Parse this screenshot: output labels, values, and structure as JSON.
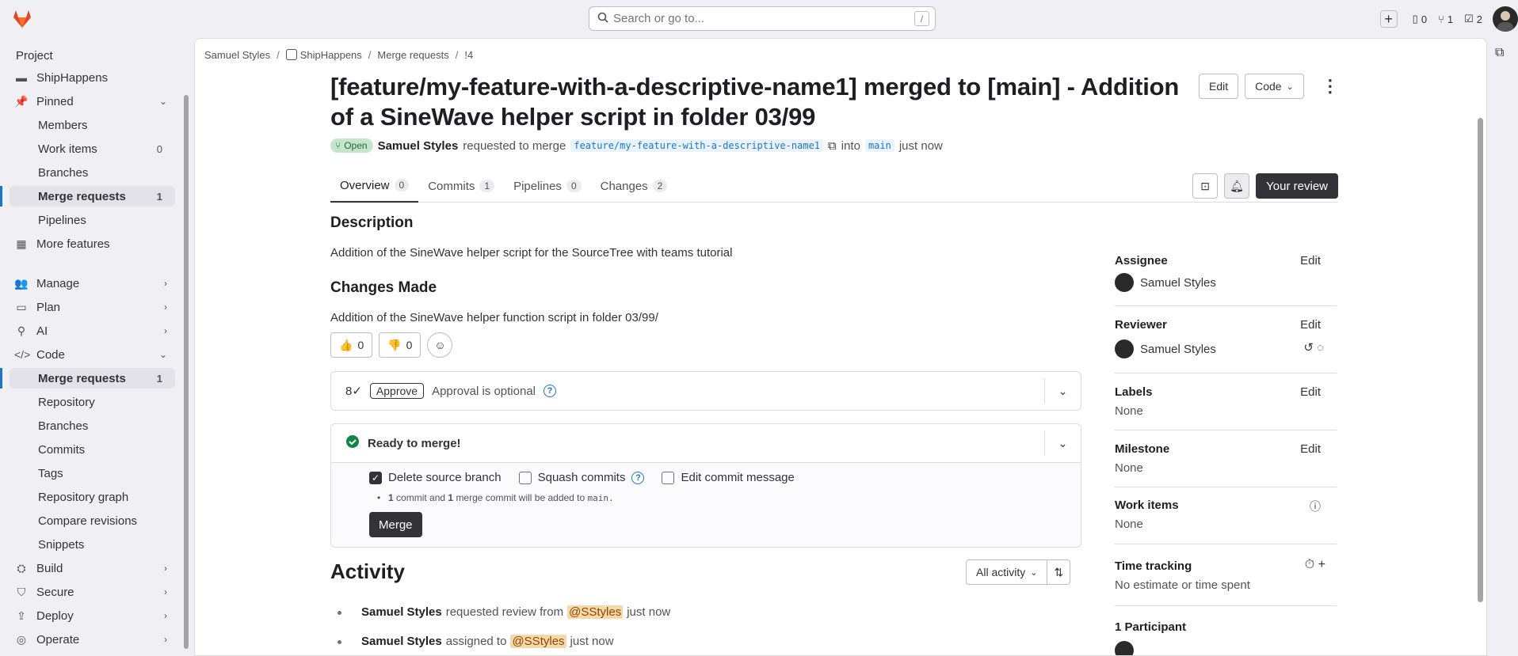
{
  "search": {
    "placeholder": "Search or go to...",
    "shortcut": "/"
  },
  "topbar": {
    "issues_count": "0",
    "mr_count": "1",
    "todo_count": "2"
  },
  "sidebar": {
    "title": "Project",
    "partial_top": "ShipHappens",
    "items": [
      {
        "label": "Pinned"
      },
      {
        "label": "Members"
      },
      {
        "label": "Work items",
        "count": "0"
      },
      {
        "label": "Branches"
      },
      {
        "label": "Merge requests",
        "count": "1"
      },
      {
        "label": "Pipelines"
      },
      {
        "label": "More features"
      },
      {
        "label": "Manage"
      },
      {
        "label": "Plan"
      },
      {
        "label": "AI"
      },
      {
        "label": "Code"
      },
      {
        "label": "Merge requests",
        "count": "1"
      },
      {
        "label": "Repository"
      },
      {
        "label": "Branches"
      },
      {
        "label": "Commits"
      },
      {
        "label": "Tags"
      },
      {
        "label": "Repository graph"
      },
      {
        "label": "Compare revisions"
      },
      {
        "label": "Snippets"
      },
      {
        "label": "Build"
      },
      {
        "label": "Secure"
      },
      {
        "label": "Deploy"
      },
      {
        "label": "Operate"
      }
    ]
  },
  "breadcrumb": [
    "Samuel Styles",
    "ShipHappens",
    "Merge requests",
    "!4"
  ],
  "mr": {
    "title": "[feature/my-feature-with-a-descriptive-name1] merged to [main] - Addition of a SineWave helper script in folder 03/99",
    "edit_label": "Edit",
    "code_label": "Code",
    "status": "Open",
    "author": "Samuel Styles",
    "requested_text": "requested to merge",
    "source_branch": "feature/my-feature-with-a-descriptive-name1",
    "into_text": "into",
    "target_branch": "main",
    "time": "just now"
  },
  "tabs": [
    {
      "label": "Overview",
      "count": "0"
    },
    {
      "label": "Commits",
      "count": "1"
    },
    {
      "label": "Pipelines",
      "count": "0"
    },
    {
      "label": "Changes",
      "count": "2"
    }
  ],
  "review_button": "Your review",
  "description": {
    "heading": "Description",
    "text": "Addition of the SineWave helper script for the SourceTree with teams tutorial",
    "changes_heading": "Changes Made",
    "changes_text": "Addition of the SineWave helper function script in folder 03/99/"
  },
  "reactions": {
    "thumbs_up": "0",
    "thumbs_down": "0"
  },
  "approval": {
    "approve_label": "Approve",
    "optional_text": "Approval is optional"
  },
  "merge": {
    "ready_text": "Ready to merge!",
    "delete_source": "Delete source branch",
    "squash": "Squash commits",
    "edit_message": "Edit commit message",
    "note_1": "1",
    "note_2": "commit and",
    "note_3": "1",
    "note_4": "merge commit will be added to",
    "note_branch": "main.",
    "merge_label": "Merge"
  },
  "activity": {
    "title": "Activity",
    "filter": "All activity",
    "items": [
      {
        "author": "Samuel Styles",
        "text": "requested review from",
        "mention": "@SStyles",
        "time": "just now"
      },
      {
        "author": "Samuel Styles",
        "text": "assigned to",
        "mention": "@SStyles",
        "time": "just now"
      }
    ]
  },
  "right_sidebar": {
    "assignee_label": "Assignee",
    "assignee": "Samuel Styles",
    "reviewer_label": "Reviewer",
    "reviewer": "Samuel Styles",
    "labels_label": "Labels",
    "labels_value": "None",
    "milestone_label": "Milestone",
    "milestone_value": "None",
    "work_items_label": "Work items",
    "work_items_value": "None",
    "time_label": "Time tracking",
    "time_value": "No estimate or time spent",
    "participants_label": "1 Participant",
    "edit": "Edit"
  },
  "colors": {
    "accent": "#1f75cb",
    "dark_button": "#333238",
    "open_badge": "#c3e6cd",
    "mention": "#f5d9a8"
  }
}
